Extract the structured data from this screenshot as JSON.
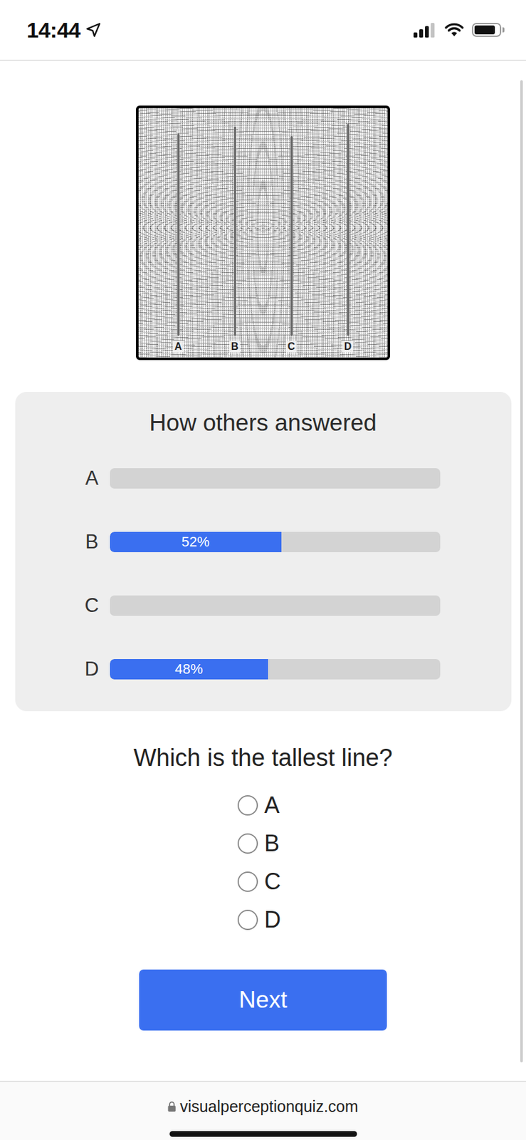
{
  "status_bar": {
    "time": "14:44",
    "signal_level": 0.75,
    "battery_level": 0.85
  },
  "figure": {
    "lines": [
      {
        "label": "A",
        "level": 0.81
      },
      {
        "label": "B",
        "level": 0.84
      },
      {
        "label": "C",
        "level": 0.8
      },
      {
        "label": "D",
        "level": 0.85
      }
    ]
  },
  "results": {
    "title": "How others answered",
    "options": [
      {
        "label": "A",
        "level": 0
      },
      {
        "label": "B",
        "level": 0.52,
        "percent": "52%"
      },
      {
        "label": "C",
        "level": 0
      },
      {
        "label": "D",
        "level": 0.48,
        "percent": "48%"
      }
    ]
  },
  "question": {
    "text": "Which is the tallest line?",
    "options": [
      {
        "label": "A",
        "selected": false
      },
      {
        "label": "B",
        "selected": false
      },
      {
        "label": "C",
        "selected": false
      },
      {
        "label": "D",
        "selected": false
      }
    ]
  },
  "button": "Next",
  "browser": {
    "url": "visualperceptionquiz.com"
  }
}
